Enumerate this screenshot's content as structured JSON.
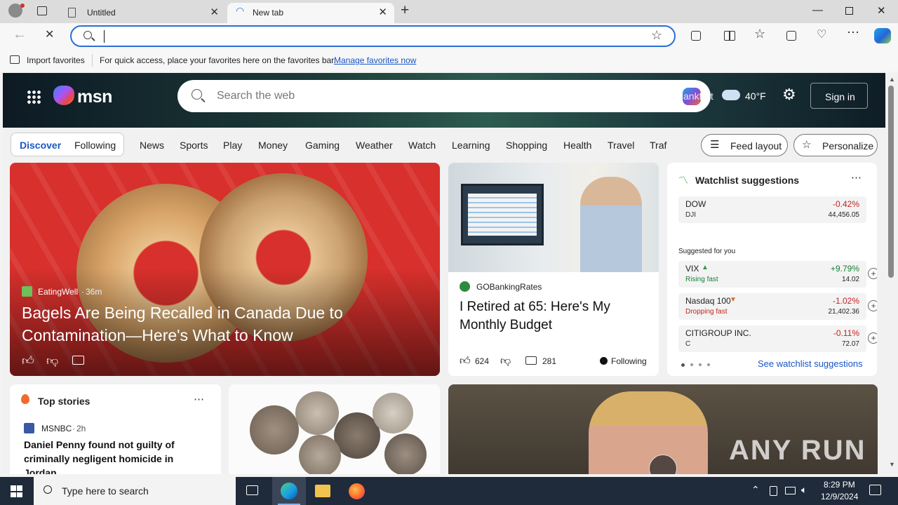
{
  "browser": {
    "tabs": [
      {
        "label": "Untitled"
      },
      {
        "label": "New tab"
      }
    ],
    "address_value": "",
    "favorites_bar": {
      "import_label": "Import favorites",
      "hint": "For quick access, place your favorites here on the favorites bar.",
      "manage_link": "Manage favorites now"
    }
  },
  "msn": {
    "logo": "msn",
    "search_placeholder": "Search the web",
    "location": "ankfurt",
    "temperature": "40°F",
    "sign_in": "Sign in",
    "nav": {
      "discover": "Discover",
      "following": "Following",
      "items": [
        "News",
        "Sports",
        "Play",
        "Money",
        "Gaming",
        "Weather",
        "Watch",
        "Learning",
        "Shopping",
        "Health",
        "Travel",
        "Traf"
      ],
      "feed_layout": "Feed layout",
      "personalize": "Personalize"
    },
    "hero_card": {
      "source": "EatingWell",
      "age": "36m",
      "headline": "Bagels Are Being Recalled in Canada Due to Contamination—Here's What to Know"
    },
    "retire_card": {
      "source": "GOBankingRates",
      "headline": "I Retired at 65: Here's My Monthly Budget",
      "likes": "624",
      "comments": "281",
      "following": "Following"
    },
    "watchlist": {
      "title": "Watchlist suggestions",
      "pinned": {
        "name": "DOW",
        "symbol": "DJI",
        "change": "-0.42%",
        "value": "44,456.05"
      },
      "suggested_label": "Suggested for you",
      "suggested": [
        {
          "name": "VIX",
          "sub": "Rising fast",
          "change": "+9.79%",
          "value": "14.02",
          "color": "#188038"
        },
        {
          "name": "Nasdaq 100",
          "sub": "Dropping fast",
          "change": "-1.02%",
          "value": "21,402.36",
          "color": "#c5221f"
        },
        {
          "name": "CITIGROUP INC.",
          "sub": "C",
          "change": "-0.11%",
          "value": "72.07",
          "color": "#c5221f"
        }
      ],
      "see_link": "See watchlist suggestions"
    },
    "top_stories": {
      "title": "Top stories",
      "source": "MSNBC",
      "age": "2h",
      "headline": "Daniel Penny found not guilty of criminally negligent homicide in Jordan..."
    },
    "watermark": "ANY RUN"
  },
  "taskbar": {
    "search_placeholder": "Type here to search",
    "time": "8:29 PM",
    "date": "12/9/2024"
  },
  "colors": {
    "accent": "#2b6fd4",
    "negative": "#c5221f",
    "positive": "#188038",
    "hero_red": "#d8302c"
  }
}
